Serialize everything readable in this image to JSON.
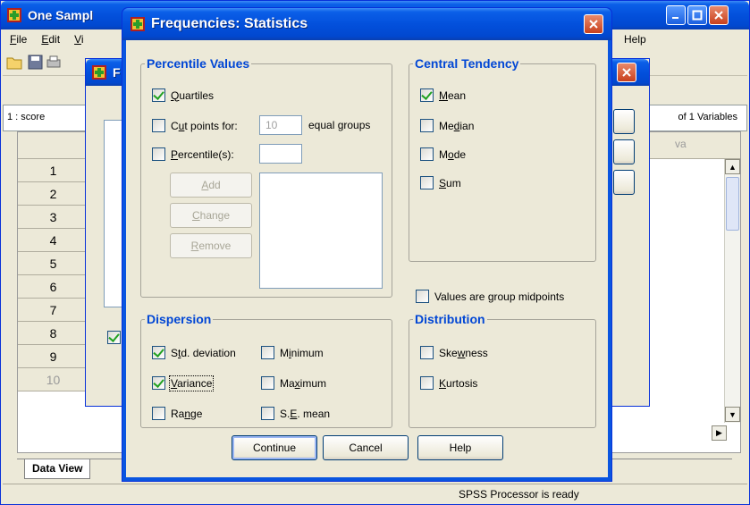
{
  "main_window": {
    "title": "One Sampl",
    "menu": [
      {
        "label": "File",
        "ul": "F",
        "rest": "ile"
      },
      {
        "label": "Edit",
        "ul": "E",
        "rest": "dit"
      },
      {
        "label": "Vi",
        "ul": "V",
        "rest": "i"
      },
      {
        "label": "Help",
        "ul": "",
        "rest": "Help"
      }
    ],
    "cell_ref": "1 : score",
    "var_count": "of 1 Variables",
    "col_header": "va",
    "rows": [
      "1",
      "2",
      "3",
      "4",
      "5",
      "6",
      "7",
      "8",
      "9",
      "10"
    ],
    "tab_data_view": "Data View",
    "status": "SPSS  Processor is ready"
  },
  "parent_dialog": {
    "title": "F"
  },
  "stats_dialog": {
    "title": "Frequencies: Statistics",
    "percentile_values": {
      "legend": "Percentile Values",
      "quartiles": {
        "pre": "",
        "ul": "Q",
        "post": "uartiles",
        "checked": true
      },
      "cut_points": {
        "pre": "C",
        "ul": "u",
        "post": "t points for:",
        "checked": false
      },
      "cut_points_value": "10",
      "equal_groups": "equal groups",
      "percentiles": {
        "pre": "",
        "ul": "P",
        "post": "ercentile(s):",
        "checked": false
      },
      "add": {
        "pre": "",
        "ul": "A",
        "post": "dd"
      },
      "change": {
        "pre": "",
        "ul": "C",
        "post": "hange"
      },
      "remove": {
        "pre": "",
        "ul": "R",
        "post": "emove"
      }
    },
    "central_tendency": {
      "legend": "Central Tendency",
      "mean": {
        "pre": "",
        "ul": "M",
        "post": "ean",
        "checked": true
      },
      "median": {
        "pre": "Me",
        "ul": "d",
        "post": "ian",
        "checked": false
      },
      "mode": {
        "pre": "M",
        "ul": "o",
        "post": "de",
        "checked": false
      },
      "sum": {
        "pre": "",
        "ul": "S",
        "post": "um",
        "checked": false
      }
    },
    "group_midpoints": {
      "label": "Values are group midpoints",
      "checked": false
    },
    "dispersion": {
      "legend": "Dispersion",
      "std_deviation": {
        "pre": "S",
        "ul": "t",
        "post": "d. deviation",
        "checked": true
      },
      "minimum": {
        "pre": "M",
        "ul": "i",
        "post": "nimum",
        "checked": false
      },
      "variance": {
        "pre": "",
        "ul": "V",
        "post": "ariance",
        "checked": true
      },
      "maximum": {
        "pre": "Ma",
        "ul": "x",
        "post": "imum",
        "checked": false
      },
      "range": {
        "pre": "Ra",
        "ul": "n",
        "post": "ge",
        "checked": false
      },
      "se_mean": {
        "pre": "S.",
        "ul": "E",
        "post": ". mean",
        "checked": false
      }
    },
    "distribution": {
      "legend": "Distribution",
      "skewness": {
        "pre": "Ske",
        "ul": "w",
        "post": "ness",
        "checked": false
      },
      "kurtosis": {
        "pre": "",
        "ul": "K",
        "post": "urtosis",
        "checked": false
      }
    },
    "buttons": {
      "continue": "Continue",
      "cancel": "Cancel",
      "help": "Help"
    }
  }
}
